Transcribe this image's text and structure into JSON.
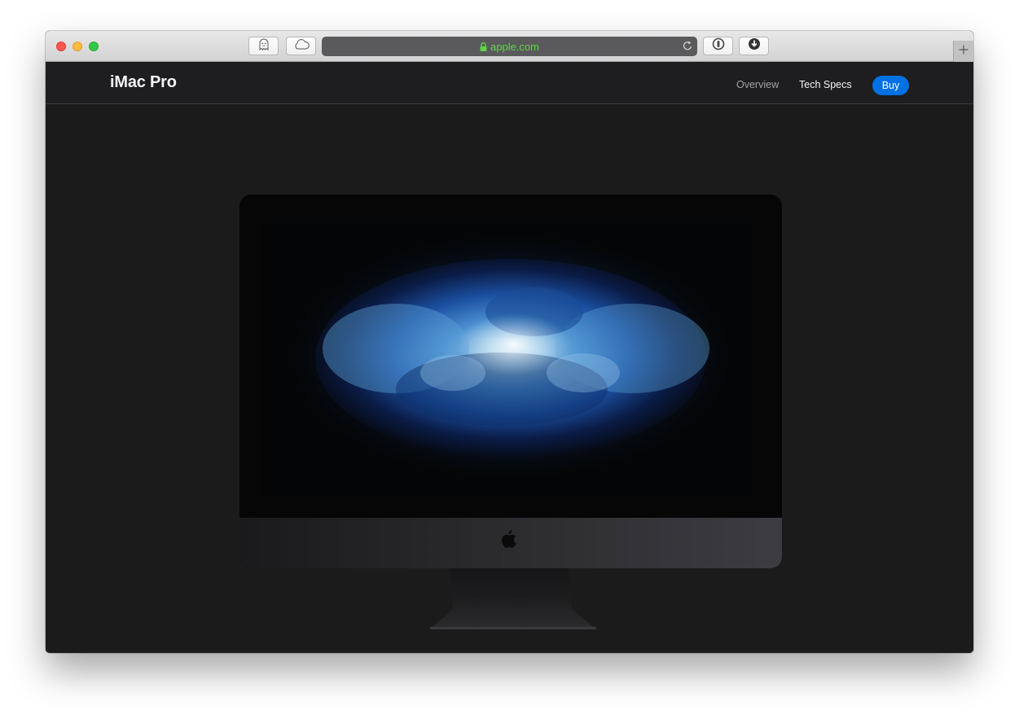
{
  "browser": {
    "url": "apple.com",
    "buttons": {
      "ghostery": "ghost-icon",
      "icloud": "cloud-icon",
      "password_manager": "1password-icon",
      "downloads": "download-icon",
      "reload": "reload-icon",
      "new_tab": "plus-icon"
    },
    "url_color": "#5fd34a"
  },
  "local_nav": {
    "product_title": "iMac Pro",
    "links": [
      {
        "label": "Overview",
        "current": true
      },
      {
        "label": "Tech Specs",
        "current": false
      }
    ],
    "buy_label": "Buy",
    "buy_color": "#0071e3"
  },
  "hero": {
    "image": "imac-pro-product-image",
    "logo": "apple-logo"
  }
}
